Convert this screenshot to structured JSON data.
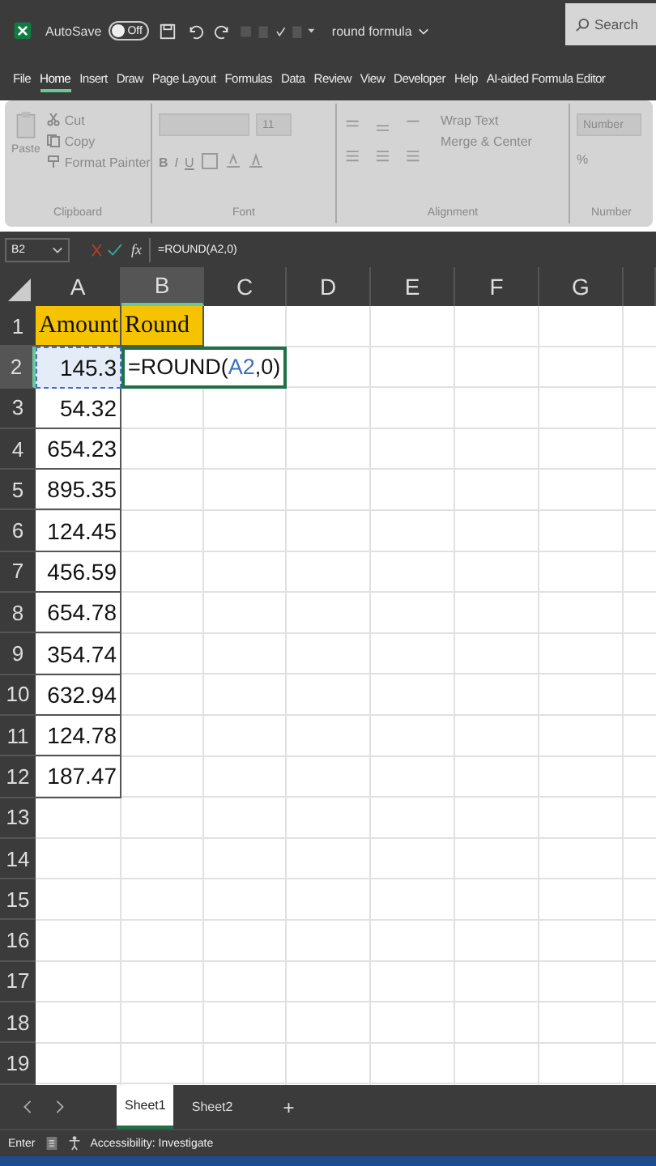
{
  "title_bar": {
    "autosave_label": "AutoSave",
    "autosave": {
      "on": false,
      "label": "Off"
    },
    "document_title": "round formula",
    "search": {
      "placeholder": "Search"
    }
  },
  "tabs": [
    {
      "label": "File",
      "selected": false
    },
    {
      "label": "Home",
      "selected": true
    },
    {
      "label": "Insert",
      "selected": false
    },
    {
      "label": "Draw",
      "selected": false
    },
    {
      "label": "Page Layout",
      "selected": false
    },
    {
      "label": "Formulas",
      "selected": false
    },
    {
      "label": "Data",
      "selected": false
    },
    {
      "label": "Review",
      "selected": false
    },
    {
      "label": "View",
      "selected": false
    },
    {
      "label": "Developer",
      "selected": false
    },
    {
      "label": "Help",
      "selected": false
    },
    {
      "label": "AI-aided Formula Editor",
      "selected": false
    }
  ],
  "ribbon": {
    "disabled": true,
    "clipboard": {
      "title": "Clipboard",
      "paste": "Paste",
      "cut": "Cut",
      "copy": "Copy",
      "format_painter": "Format Painter"
    },
    "font": {
      "title": "Font",
      "size": "11",
      "bold": "B",
      "italic": "I",
      "underline": "U"
    },
    "alignment": {
      "title": "Alignment",
      "wrap_text": "Wrap Text",
      "merge": "Merge & Center"
    },
    "number": {
      "title": "Number",
      "format": "Number",
      "percent": "%"
    }
  },
  "formula_bar": {
    "name_box": "B2",
    "fx": "fx",
    "formula": "=ROUND(A2,0)"
  },
  "columns": [
    {
      "label": "A",
      "selected": false
    },
    {
      "label": "B",
      "selected": true
    },
    {
      "label": "C",
      "selected": false
    },
    {
      "label": "D",
      "selected": false
    },
    {
      "label": "E",
      "selected": false
    },
    {
      "label": "F",
      "selected": false
    },
    {
      "label": "G",
      "selected": false
    }
  ],
  "rows": [
    {
      "label": "1",
      "selected": false,
      "cells": [
        {
          "kind": "header",
          "text": "Amount"
        },
        {
          "kind": "header",
          "text": "Round"
        }
      ]
    },
    {
      "label": "2",
      "selected": true,
      "cells": [
        {
          "kind": "reference",
          "text": "145.3"
        },
        {
          "kind": "formula",
          "parts": [
            {
              "kind": "plain",
              "text": "=ROUND("
            },
            {
              "kind": "ref",
              "text": "A2"
            },
            {
              "kind": "plain",
              "text": ",0)"
            }
          ]
        }
      ]
    },
    {
      "label": "3",
      "selected": false,
      "cells": [
        {
          "kind": "number",
          "text": "54.32"
        },
        {
          "kind": "empty"
        }
      ]
    },
    {
      "label": "4",
      "selected": false,
      "cells": [
        {
          "kind": "number",
          "text": "654.23"
        },
        {
          "kind": "empty"
        }
      ]
    },
    {
      "label": "5",
      "selected": false,
      "cells": [
        {
          "kind": "number",
          "text": "895.35"
        },
        {
          "kind": "empty"
        }
      ]
    },
    {
      "label": "6",
      "selected": false,
      "cells": [
        {
          "kind": "number",
          "text": "124.45"
        },
        {
          "kind": "empty"
        }
      ]
    },
    {
      "label": "7",
      "selected": false,
      "cells": [
        {
          "kind": "number",
          "text": "456.59"
        },
        {
          "kind": "empty"
        }
      ]
    },
    {
      "label": "8",
      "selected": false,
      "cells": [
        {
          "kind": "number",
          "text": "654.78"
        },
        {
          "kind": "empty"
        }
      ]
    },
    {
      "label": "9",
      "selected": false,
      "cells": [
        {
          "kind": "number",
          "text": "354.74"
        },
        {
          "kind": "empty"
        }
      ]
    },
    {
      "label": "10",
      "selected": false,
      "cells": [
        {
          "kind": "number",
          "text": "632.94"
        },
        {
          "kind": "empty"
        }
      ]
    },
    {
      "label": "11",
      "selected": false,
      "cells": [
        {
          "kind": "number",
          "text": "124.78"
        },
        {
          "kind": "empty"
        }
      ]
    },
    {
      "label": "12",
      "selected": false,
      "cells": [
        {
          "kind": "number",
          "text": "187.47"
        },
        {
          "kind": "empty"
        }
      ]
    },
    {
      "label": "13",
      "selected": false,
      "cells": []
    },
    {
      "label": "14",
      "selected": false,
      "cells": []
    },
    {
      "label": "15",
      "selected": false,
      "cells": []
    },
    {
      "label": "16",
      "selected": false,
      "cells": []
    },
    {
      "label": "17",
      "selected": false,
      "cells": []
    },
    {
      "label": "18",
      "selected": false,
      "cells": []
    },
    {
      "label": "19",
      "selected": false,
      "cells": []
    }
  ],
  "sheet_tabs": [
    {
      "label": "Sheet1",
      "selected": true
    },
    {
      "label": "Sheet2",
      "selected": false
    }
  ],
  "add_sheet": "+",
  "status_bar": {
    "mode": "Enter",
    "accessibility": "Accessibility: Investigate"
  }
}
